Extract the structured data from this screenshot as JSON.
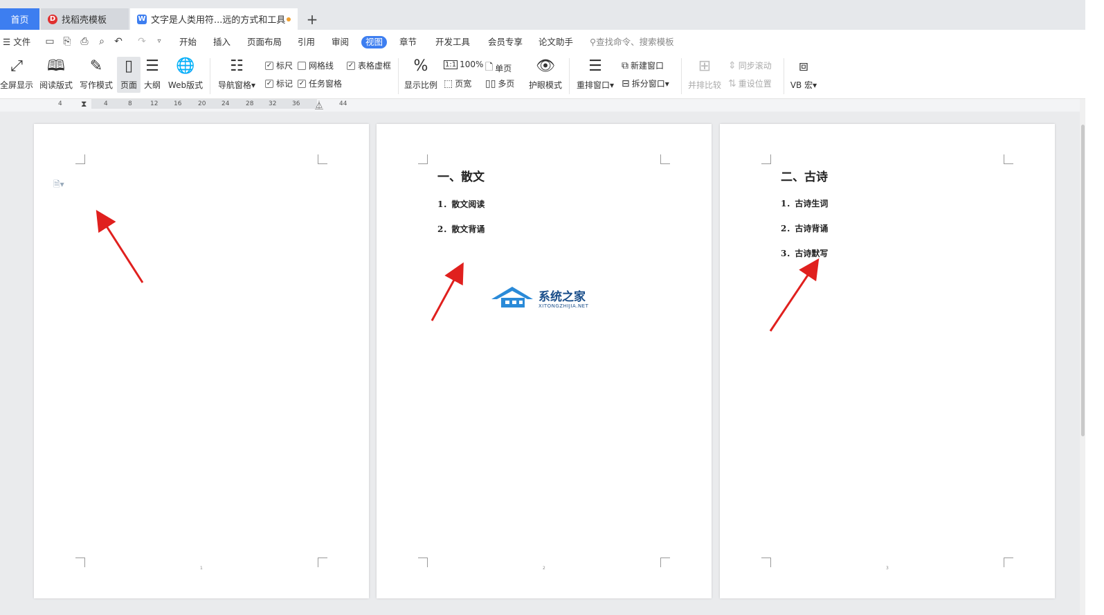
{
  "tabs": {
    "home": "首页",
    "docer": "找稻壳模板",
    "doc": "文字是人类用符...远的方式和工具",
    "add": "+"
  },
  "menu": {
    "file": "文件",
    "items": [
      "开始",
      "插入",
      "页面布局",
      "引用",
      "审阅",
      "视图",
      "章节",
      "开发工具",
      "会员专享",
      "论文助手"
    ],
    "active": "视图",
    "search": "查找命令、搜索模板"
  },
  "toolbar": {
    "fullscreen": "全屏显示",
    "reading": "阅读版式",
    "writing": "写作模式",
    "page": "页面",
    "outline": "大纲",
    "web": "Web版式",
    "nav_pane": "导航窗格",
    "ruler": "标尺",
    "gridlines": "网格线",
    "table_border": "表格虚框",
    "marks": "标记",
    "task_pane": "任务窗格",
    "zoom": "显示比例",
    "zoom100": "100%",
    "page_width": "页宽",
    "single_page": "单页",
    "multi_page": "多页",
    "eye_protect": "护眼模式",
    "arrange": "重排窗口",
    "new_window": "新建窗口",
    "split_window": "拆分窗口",
    "side_by_side": "并排比较",
    "sync_scroll": "同步滚动",
    "reset_pos": "重设位置",
    "vb_macro": "VB 宏"
  },
  "ruler": [
    "4",
    "4",
    "8",
    "12",
    "16",
    "20",
    "24",
    "28",
    "32",
    "36",
    "44"
  ],
  "pages": [
    {
      "title": "",
      "items": [],
      "number": "1"
    },
    {
      "title": "一、散文",
      "items": [
        "1．散文阅读",
        "2．散文背诵"
      ],
      "number": "2"
    },
    {
      "title": "二、古诗",
      "items": [
        "1．古诗生词",
        "2．古诗背诵",
        "3．古诗默写"
      ],
      "number": "3"
    }
  ],
  "watermark": {
    "cn": "系统之家",
    "en": "XITONGZHIJIA.NET"
  },
  "colors": {
    "accent": "#3d7ef0",
    "arrow": "#e0201e"
  }
}
